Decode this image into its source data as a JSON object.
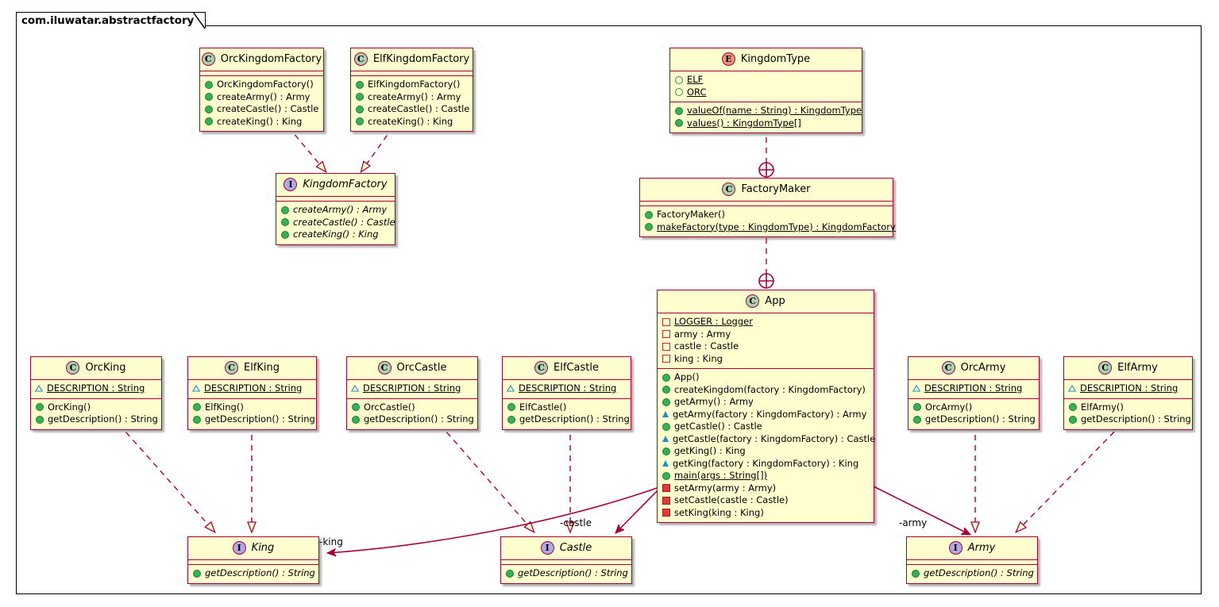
{
  "package": {
    "name": "com.iluwatar.abstractfactory"
  },
  "icons": {
    "class": "C",
    "interface": "I",
    "enum": "E"
  },
  "classes": {
    "orc_kingdom_factory": {
      "name": "OrcKingdomFactory",
      "kind": "class",
      "methods": [
        "OrcKingdomFactory()",
        "createArmy() : Army",
        "createCastle() : Castle",
        "createKing() : King"
      ]
    },
    "elf_kingdom_factory": {
      "name": "ElfKingdomFactory",
      "kind": "class",
      "methods": [
        "ElfKingdomFactory()",
        "createArmy() : Army",
        "createCastle() : Castle",
        "createKing() : King"
      ]
    },
    "kingdom_factory": {
      "name": "KingdomFactory",
      "kind": "interface",
      "methods": [
        "createArmy() : Army",
        "createCastle() : Castle",
        "createKing() : King"
      ]
    },
    "kingdom_type": {
      "name": "KingdomType",
      "kind": "enum",
      "values": [
        "ELF",
        "ORC"
      ],
      "methods": [
        "valueOf(name : String) : KingdomType",
        "values() : KingdomType[]"
      ]
    },
    "factory_maker": {
      "name": "FactoryMaker",
      "kind": "class",
      "methods": [
        "FactoryMaker()",
        "makeFactory(type : KingdomType) : KingdomFactory"
      ]
    },
    "app": {
      "name": "App",
      "kind": "class",
      "fields": [
        "LOGGER : Logger",
        "army : Army",
        "castle : Castle",
        "king : King"
      ],
      "methods": [
        "App()",
        "createKingdom(factory : KingdomFactory)",
        "getArmy() : Army",
        "getArmy(factory : KingdomFactory) : Army",
        "getCastle() : Castle",
        "getCastle(factory : KingdomFactory) : Castle",
        "getKing() : King",
        "getKing(factory : KingdomFactory) : King",
        "main(args : String[])",
        "setArmy(army : Army)",
        "setCastle(castle : Castle)",
        "setKing(king : King)"
      ]
    },
    "orc_king": {
      "name": "OrcKing",
      "kind": "class",
      "field": "DESCRIPTION : String",
      "methods": [
        "OrcKing()",
        "getDescription() : String"
      ]
    },
    "elf_king": {
      "name": "ElfKing",
      "kind": "class",
      "field": "DESCRIPTION : String",
      "methods": [
        "ElfKing()",
        "getDescription() : String"
      ]
    },
    "orc_castle": {
      "name": "OrcCastle",
      "kind": "class",
      "field": "DESCRIPTION : String",
      "methods": [
        "OrcCastle()",
        "getDescription() : String"
      ]
    },
    "elf_castle": {
      "name": "ElfCastle",
      "kind": "class",
      "field": "DESCRIPTION : String",
      "methods": [
        "ElfCastle()",
        "getDescription() : String"
      ]
    },
    "orc_army": {
      "name": "OrcArmy",
      "kind": "class",
      "field": "DESCRIPTION : String",
      "methods": [
        "OrcArmy()",
        "getDescription() : String"
      ]
    },
    "elf_army": {
      "name": "ElfArmy",
      "kind": "class",
      "field": "DESCRIPTION : String",
      "methods": [
        "ElfArmy()",
        "getDescription() : String"
      ]
    },
    "king": {
      "name": "King",
      "kind": "interface",
      "methods": [
        "getDescription() : String"
      ]
    },
    "castle": {
      "name": "Castle",
      "kind": "interface",
      "methods": [
        "getDescription() : String"
      ]
    },
    "army": {
      "name": "Army",
      "kind": "interface",
      "methods": [
        "getDescription() : String"
      ]
    }
  },
  "association_labels": {
    "king": "-king",
    "castle": "-castle",
    "army": "-army"
  },
  "colors": {
    "box_fill": "#FEFECE",
    "box_border": "#A80036",
    "line": "#A80036",
    "class_icon": "#ADD1B2",
    "interface_icon": "#B4A7E5",
    "enum_icon": "#EB937F",
    "public_marker": "#38B058",
    "protected_marker": "#1E90C8",
    "private_marker": "#C82930",
    "frame_border": "#000000"
  }
}
